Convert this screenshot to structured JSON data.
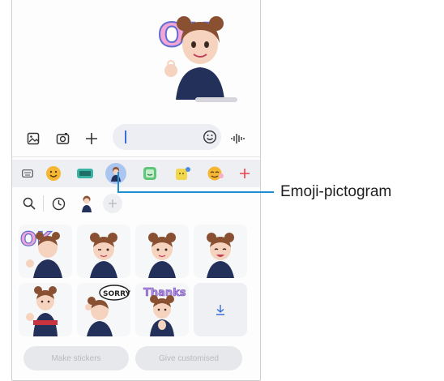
{
  "message": {
    "timestamp": ""
  },
  "input": {
    "placeholder": ""
  },
  "input_icons": [
    "gallery-icon",
    "camera-icon",
    "plus-icon",
    "emoji-icon",
    "voice-icon"
  ],
  "categories": [
    {
      "name": "keyboard-icon"
    },
    {
      "name": "emoji-smiley"
    },
    {
      "name": "gif-icon"
    },
    {
      "name": "ar-emoji-avatar",
      "selected": true
    },
    {
      "name": "sticker-icon"
    },
    {
      "name": "animated-emoji"
    },
    {
      "name": "emoji-sticker"
    },
    {
      "name": "add-icon"
    }
  ],
  "sub_row": [
    "search-icon",
    "recent-icon",
    "avatar-tab",
    "add-avatar-icon"
  ],
  "bottom": {
    "make_stickers": "Make stickers",
    "give_customised": "Give customised"
  },
  "callout": {
    "label": "Emoji-pictogram"
  },
  "colors": {
    "accent": "#1d8fd0",
    "selected_bg": "#a9c5f0",
    "red_plus": "#e8414d"
  }
}
